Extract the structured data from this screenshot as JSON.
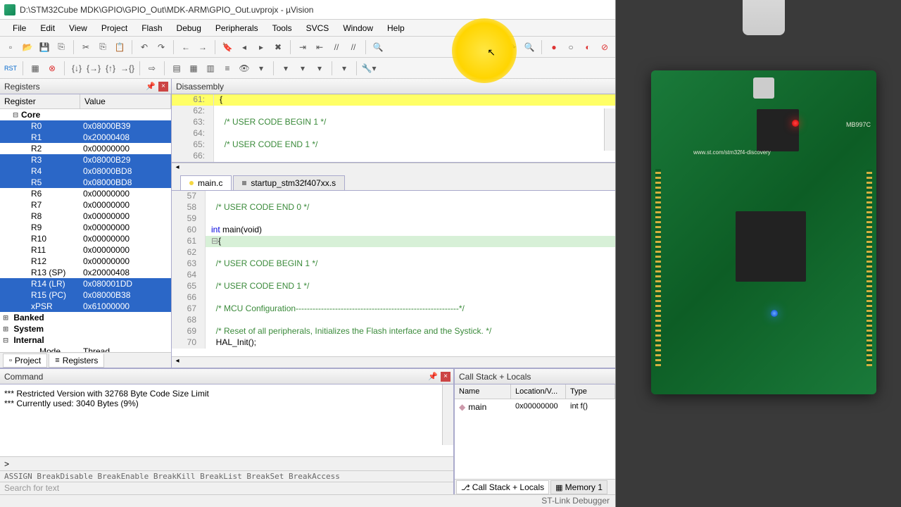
{
  "title": "D:\\STM32Cube MDK\\GPIO\\GPIO_Out\\MDK-ARM\\GPIO_Out.uvprojx - µVision",
  "menu": [
    "File",
    "Edit",
    "View",
    "Project",
    "Flash",
    "Debug",
    "Peripherals",
    "Tools",
    "SVCS",
    "Window",
    "Help"
  ],
  "panes": {
    "registers": "Registers",
    "disassembly": "Disassembly",
    "command": "Command",
    "callstack": "Call Stack + Locals"
  },
  "reg_columns": {
    "name": "Register",
    "value": "Value"
  },
  "reg_groups": {
    "core": "Core",
    "banked": "Banked",
    "system": "System",
    "internal": "Internal"
  },
  "registers": [
    {
      "name": "R0",
      "value": "0x08000B39",
      "sel": true
    },
    {
      "name": "R1",
      "value": "0x20000408",
      "sel": true
    },
    {
      "name": "R2",
      "value": "0x00000000",
      "sel": false
    },
    {
      "name": "R3",
      "value": "0x08000B29",
      "sel": true
    },
    {
      "name": "R4",
      "value": "0x08000BD8",
      "sel": true
    },
    {
      "name": "R5",
      "value": "0x08000BD8",
      "sel": true
    },
    {
      "name": "R6",
      "value": "0x00000000",
      "sel": false
    },
    {
      "name": "R7",
      "value": "0x00000000",
      "sel": false
    },
    {
      "name": "R8",
      "value": "0x00000000",
      "sel": false
    },
    {
      "name": "R9",
      "value": "0x00000000",
      "sel": false
    },
    {
      "name": "R10",
      "value": "0x00000000",
      "sel": false
    },
    {
      "name": "R11",
      "value": "0x00000000",
      "sel": false
    },
    {
      "name": "R12",
      "value": "0x00000000",
      "sel": false
    },
    {
      "name": "R13 (SP)",
      "value": "0x20000408",
      "sel": false
    },
    {
      "name": "R14 (LR)",
      "value": "0x080001DD",
      "sel": true
    },
    {
      "name": "R15 (PC)",
      "value": "0x08000B38",
      "sel": true
    },
    {
      "name": "xPSR",
      "value": "0x61000000",
      "sel": true
    }
  ],
  "internal_rows": [
    {
      "name": "Mode",
      "value": "Thread"
    }
  ],
  "bottom_tabs": {
    "project": "Project",
    "registers": "Registers"
  },
  "disasm_lines": [
    {
      "n": "61:",
      "t": "{",
      "hl": true
    },
    {
      "n": "62:",
      "t": "",
      "hl": false
    },
    {
      "n": "63:",
      "t": "  /* USER CODE BEGIN 1 */",
      "hl": false,
      "cmt": true
    },
    {
      "n": "64:",
      "t": "",
      "hl": false
    },
    {
      "n": "65:",
      "t": "  /* USER CODE END 1 */",
      "hl": false,
      "cmt": true
    },
    {
      "n": "66:",
      "t": "",
      "hl": false
    }
  ],
  "file_tabs": [
    {
      "name": "main.c",
      "active": true
    },
    {
      "name": "startup_stm32f407xx.s",
      "active": false
    }
  ],
  "editor_lines": [
    {
      "n": 57,
      "t": ""
    },
    {
      "n": 58,
      "t": "  /* USER CODE END 0 */",
      "cmt": true
    },
    {
      "n": 59,
      "t": ""
    },
    {
      "n": 60,
      "t": "int main(void)",
      "kw": "int"
    },
    {
      "n": 61,
      "t": "{",
      "curr": true,
      "fold": true
    },
    {
      "n": 62,
      "t": ""
    },
    {
      "n": 63,
      "t": "  /* USER CODE BEGIN 1 */",
      "cmt": true
    },
    {
      "n": 64,
      "t": ""
    },
    {
      "n": 65,
      "t": "  /* USER CODE END 1 */",
      "cmt": true
    },
    {
      "n": 66,
      "t": ""
    },
    {
      "n": 67,
      "t": "  /* MCU Configuration----------------------------------------------------------*/",
      "cmt": true
    },
    {
      "n": 68,
      "t": ""
    },
    {
      "n": 69,
      "t": "  /* Reset of all peripherals, Initializes the Flash interface and the Systick. */",
      "cmt": true
    },
    {
      "n": 70,
      "t": "  HAL_Init();"
    }
  ],
  "command_output": [
    "*** Restricted Version with 32768 Byte Code Size Limit",
    "*** Currently used: 3040 Bytes (9%)"
  ],
  "command_prompt": ">",
  "command_hints": "ASSIGN BreakDisable BreakEnable BreakKill BreakList BreakSet BreakAccess",
  "search_placeholder": "Search for text",
  "stack_cols": {
    "name": "Name",
    "loc": "Location/V...",
    "type": "Type"
  },
  "stack_rows": [
    {
      "name": "main",
      "loc": "0x00000000",
      "type": "int f()"
    }
  ],
  "stack_tabs": {
    "callstack": "Call Stack + Locals",
    "memory": "Memory 1"
  },
  "status_text": "ST-Link Debugger",
  "board": {
    "model": "MB997C",
    "url": "www.st.com/stm32f4-discovery"
  }
}
